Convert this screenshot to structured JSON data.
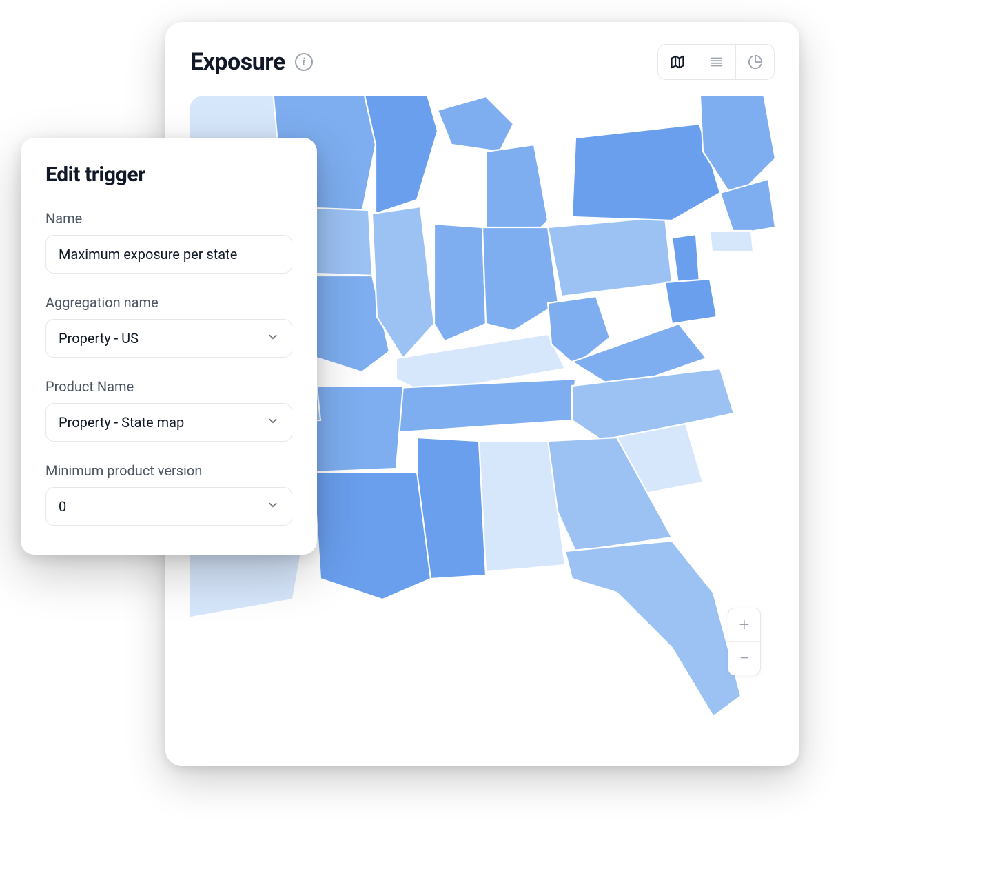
{
  "exposure": {
    "title": "Exposure",
    "views": {
      "map_active": true
    }
  },
  "edit_panel": {
    "title": "Edit trigger",
    "fields": {
      "name": {
        "label": "Name",
        "value": "Maximum exposure per state"
      },
      "aggregation": {
        "label": "Aggregation name",
        "value": "Property - US"
      },
      "product": {
        "label": "Product Name",
        "value": "Property - State map"
      },
      "min_version": {
        "label": "Minimum product version",
        "value": "0"
      }
    }
  },
  "map": {
    "zoom": {
      "in_label": "+",
      "out_label": "−"
    },
    "colors": {
      "light": "#d6e6fb",
      "mid": "#9cc2f4",
      "midblue": "#7eaef0",
      "dark": "#6a9fee"
    }
  }
}
